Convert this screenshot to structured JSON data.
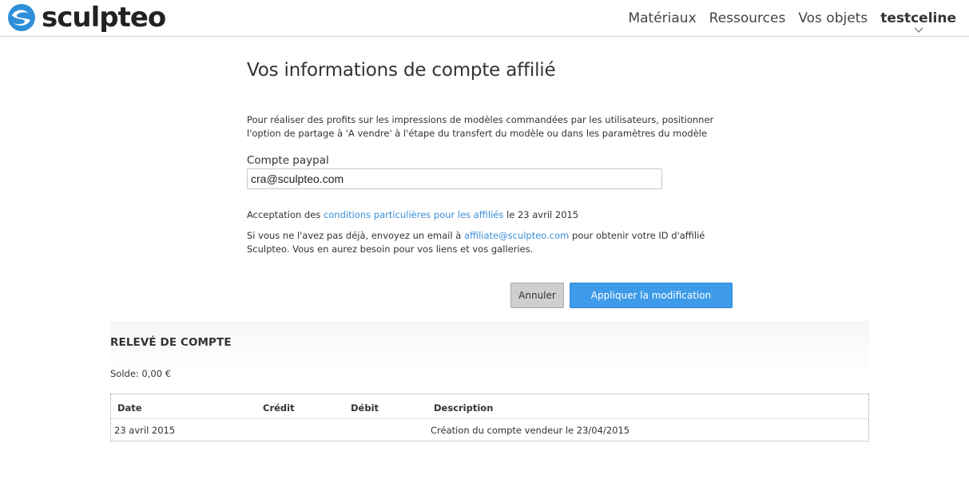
{
  "header": {
    "logo_text": "sculpteo",
    "nav": [
      "Matériaux",
      "Ressources",
      "Vos objets"
    ],
    "user": "testceline"
  },
  "main": {
    "title": "Vos informations de compte affilié",
    "intro": "Pour réaliser des profits sur les impressions de modèles commandées par les utilisateurs, positionner l'option de partage à 'A vendre' à l'étape du transfert du modèle ou dans les paramètres du modèle",
    "paypal_label": "Compte paypal",
    "paypal_value": "cra@sculpteo.com",
    "accept_prefix": "Acceptation des",
    "accept_link": "conditions particulières pour les affiliés",
    "accept_suffix": "le 23 avril 2015",
    "info_prefix": "Si vous ne l'avez pas déjà, envoyez un email à",
    "info_email": "affiliate@sculpteo.com",
    "info_suffix": "pour obtenir votre ID d'affilié Sculpteo. Vous en aurez besoin pour vos liens et vos galleries.",
    "cancel_label": "Annuler",
    "apply_label": "Appliquer la modification"
  },
  "statement": {
    "title": "RELEVÉ DE COMPTE",
    "balance": "Solde: 0,00 €",
    "columns": [
      "Date",
      "Crédit",
      "Débit",
      "Description"
    ],
    "rows": [
      {
        "date": "23 avril 2015",
        "credit": "",
        "debit": "",
        "description": "Création du compte vendeur le 23/04/2015"
      }
    ]
  },
  "colors": {
    "accent": "#3d9be9",
    "link": "#3a8fd8",
    "logo_blue": "#2e8fd9"
  },
  "icons": {
    "logo": "sculpteo-s-logo-icon",
    "user_menu": "chevron-down-icon"
  }
}
